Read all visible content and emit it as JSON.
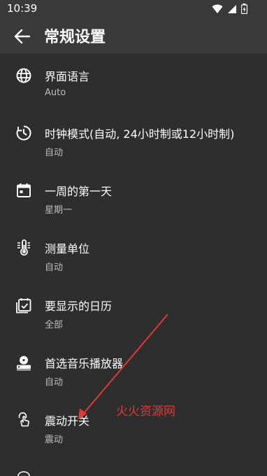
{
  "status": {
    "time": "10:39",
    "icons": [
      "wifi-icon",
      "signal-icon",
      "battery-icon"
    ]
  },
  "header": {
    "title": "常规设置",
    "back_icon": "arrow-left-icon"
  },
  "settings": {
    "items": [
      {
        "label": "界面语言",
        "value": "Auto",
        "icon": "globe-icon"
      },
      {
        "label": "时钟模式(自动, 24小时制或12小时制)",
        "value": "自动",
        "icon": "clock-icon"
      },
      {
        "label": "一周的第一天",
        "value": "星期一",
        "icon": "calendar-icon"
      },
      {
        "label": "测量单位",
        "value": "自动",
        "icon": "thermometer-icon"
      },
      {
        "label": "要显示的日历",
        "value": "全部",
        "icon": "calendar-check-icon"
      },
      {
        "label": "首选音乐播放器",
        "value": "自动",
        "icon": "music-player-icon"
      },
      {
        "label": "震动开关",
        "value": "震动",
        "icon": "touch-icon"
      }
    ]
  },
  "watermark": {
    "text": "火火资源网"
  },
  "colors": {
    "accent": "#e53935",
    "bar": "#3a3a3a",
    "bg": "#2e2e2e"
  }
}
